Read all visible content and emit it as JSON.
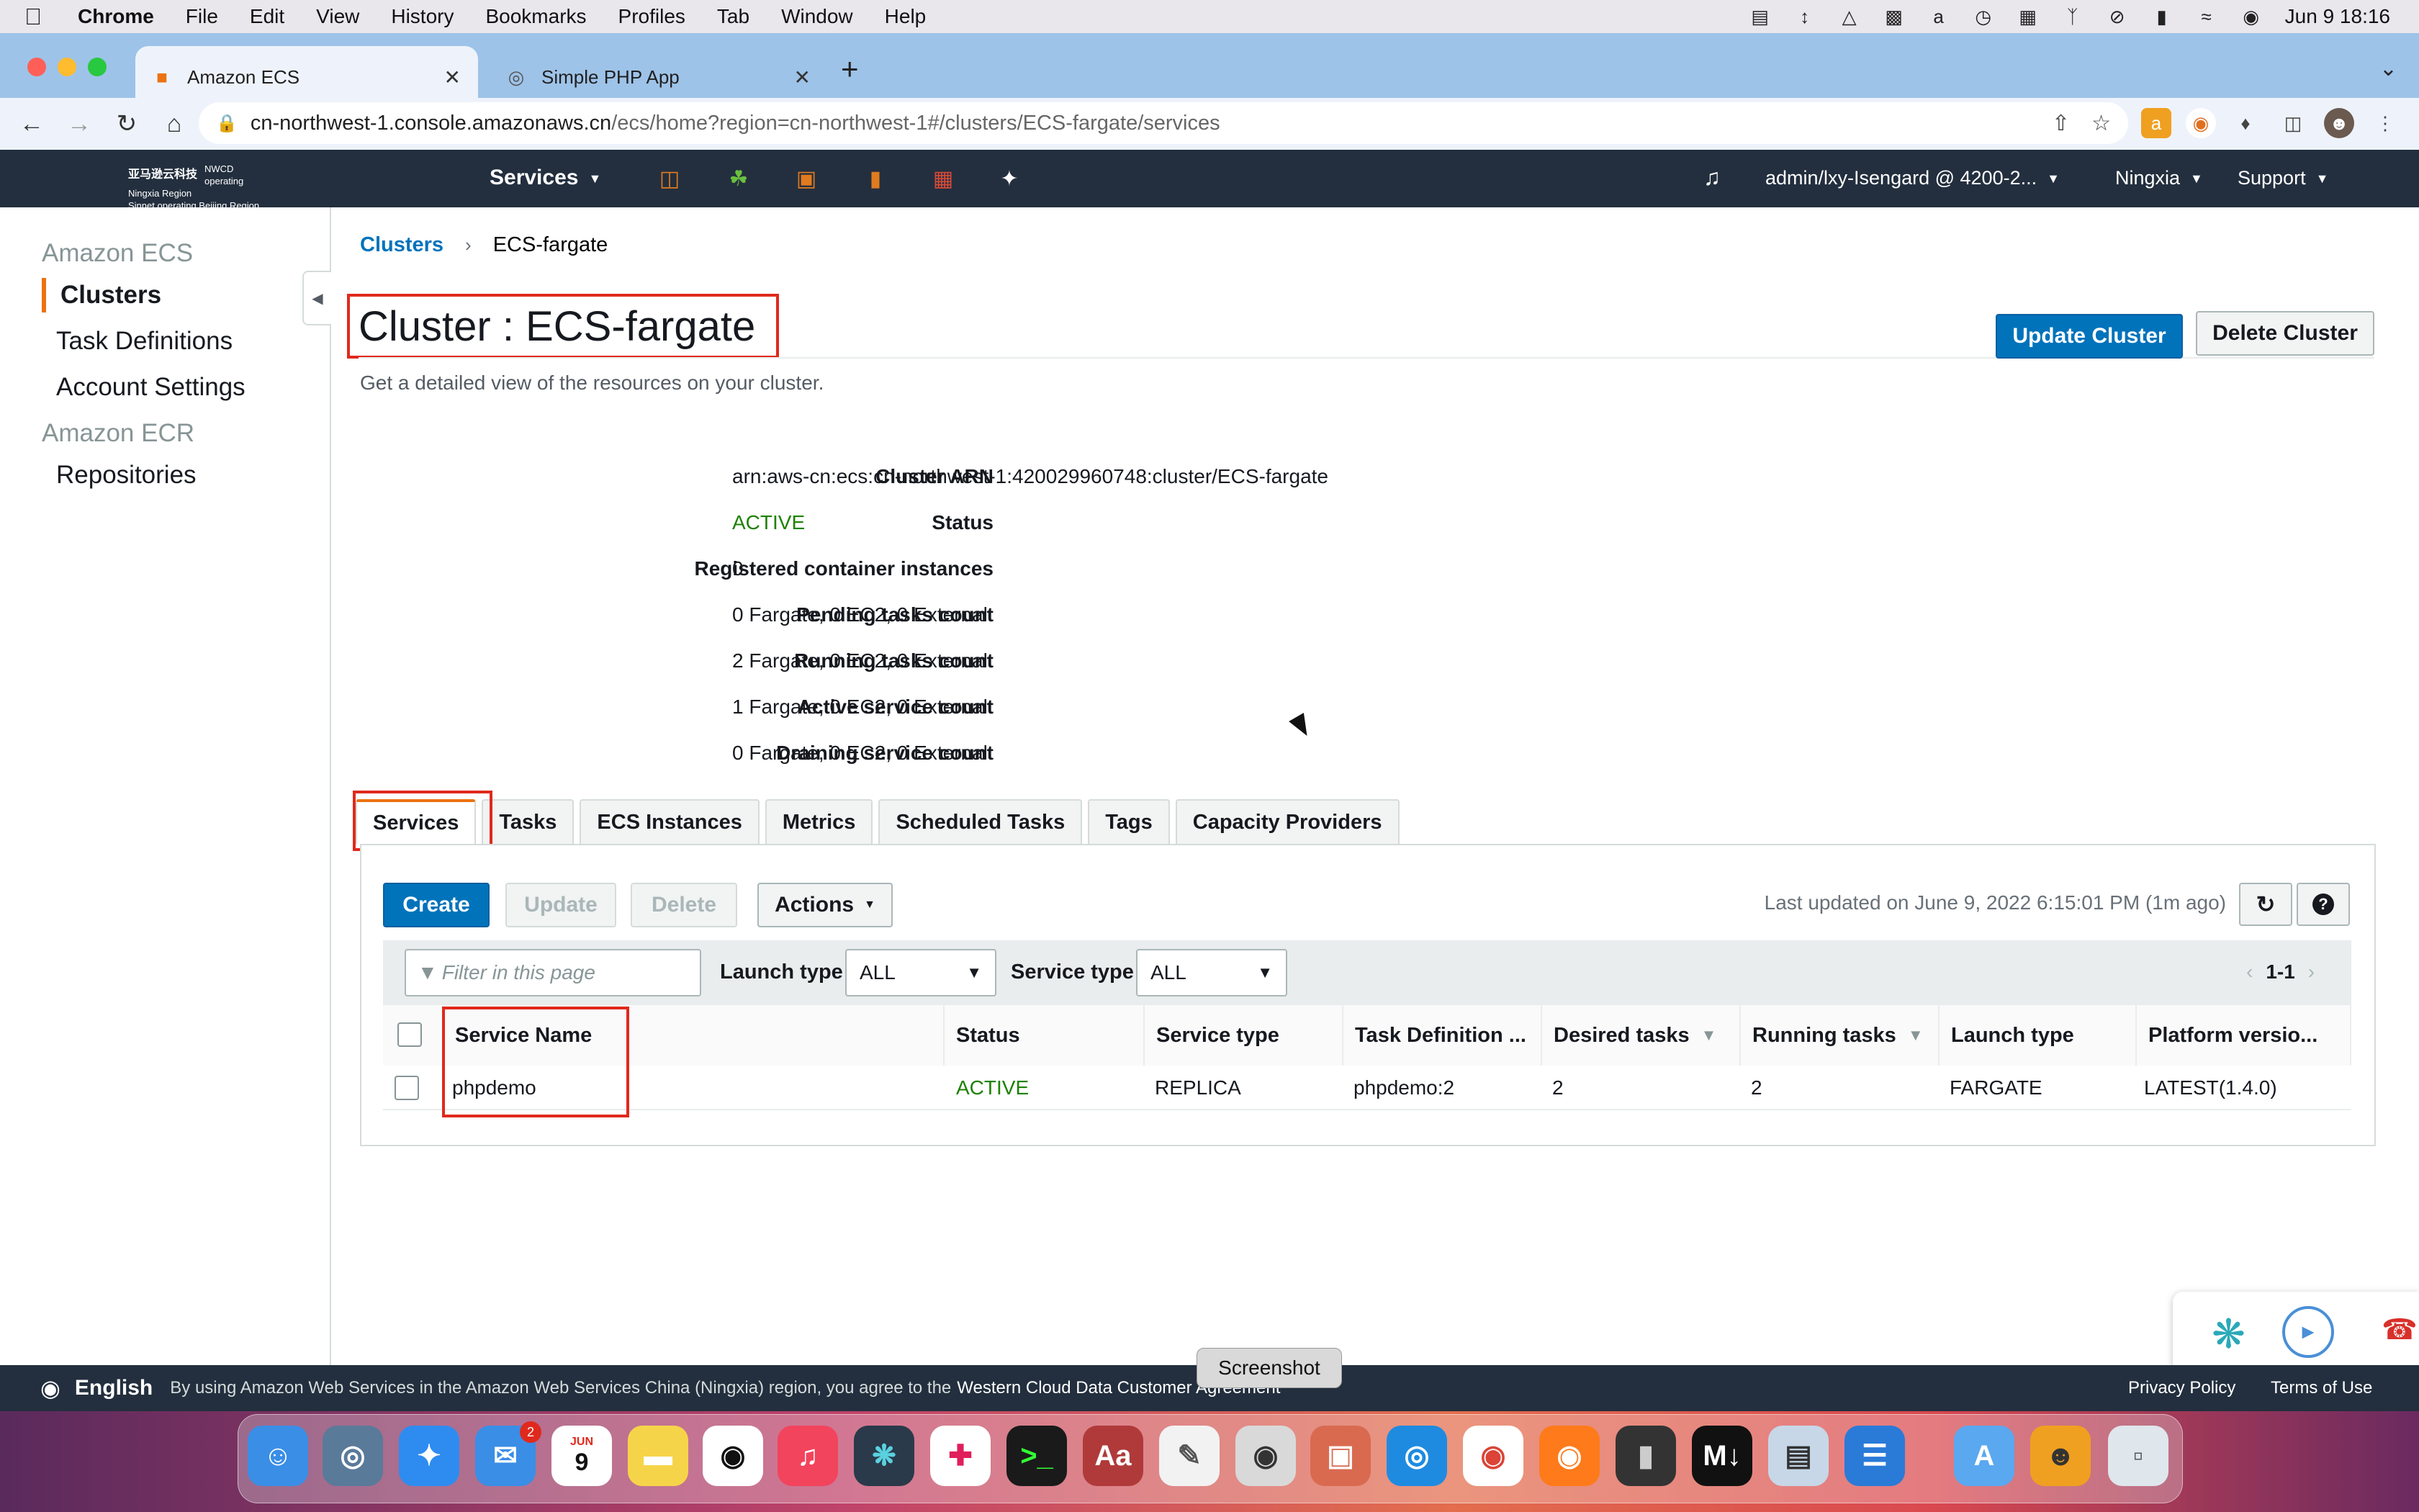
{
  "menubar": {
    "app": "Chrome",
    "items": [
      "File",
      "Edit",
      "View",
      "History",
      "Bookmarks",
      "Profiles",
      "Tab",
      "Window",
      "Help"
    ],
    "clock": "Jun 9  18:16"
  },
  "browser": {
    "tabs": [
      {
        "title": "Amazon ECS",
        "active": true
      },
      {
        "title": "Simple PHP App",
        "active": false
      }
    ],
    "url_host": "cn-northwest-1.console.amazonaws.cn",
    "url_path": "/ecs/home?region=cn-northwest-1#/clusters/ECS-fargate/services"
  },
  "aws_header": {
    "logo_line1": "NWCD operating Ningxia Region",
    "logo_line2": "Sinnet operating Beijing Region",
    "logo_cn": "亚马逊云科技",
    "services": "Services",
    "user": "admin/lxy-Isengard @ 4200-2...",
    "region": "Ningxia",
    "support": "Support"
  },
  "sidebar": {
    "section_ecs": "Amazon ECS",
    "items_ecs": [
      "Clusters",
      "Task Definitions",
      "Account Settings"
    ],
    "section_ecr": "Amazon ECR",
    "items_ecr": [
      "Repositories"
    ]
  },
  "breadcrumb": {
    "root": "Clusters",
    "current": "ECS-fargate"
  },
  "page": {
    "title": "Cluster : ECS-fargate",
    "subtitle": "Get a detailed view of the resources on your cluster.",
    "update_button": "Update Cluster",
    "delete_button": "Delete Cluster"
  },
  "details": [
    {
      "label": "Cluster ARN",
      "value": "arn:aws-cn:ecs:cn-northwest-1:420029960748:cluster/ECS-fargate"
    },
    {
      "label": "Status",
      "value": "ACTIVE"
    },
    {
      "label": "Registered container instances",
      "value": "0"
    },
    {
      "label": "Pending tasks count",
      "value": "0 Fargate, 0 EC2, 0 External"
    },
    {
      "label": "Running tasks count",
      "value": "2 Fargate, 0 EC2, 0 External"
    },
    {
      "label": "Active service count",
      "value": "1 Fargate, 0 EC2, 0 External"
    },
    {
      "label": "Draining service count",
      "value": "0 Fargate, 0 EC2, 0 External"
    }
  ],
  "tabs": [
    "Services",
    "Tasks",
    "ECS Instances",
    "Metrics",
    "Scheduled Tasks",
    "Tags",
    "Capacity Providers"
  ],
  "services_panel": {
    "create": "Create",
    "update": "Update",
    "delete": "Delete",
    "actions": "Actions",
    "last_updated": "Last updated on June 9, 2022 6:15:01 PM (1m ago)",
    "filter_placeholder": "Filter in this page",
    "launch_type_label": "Launch type",
    "launch_type_value": "ALL",
    "service_type_label": "Service type",
    "service_type_value": "ALL",
    "pager": "1-1"
  },
  "table": {
    "columns": [
      "Service Name",
      "Status",
      "Service type",
      "Task Definition ...",
      "Desired tasks",
      "Running tasks",
      "Launch type",
      "Platform versio..."
    ],
    "rows": [
      {
        "service_name": "phpdemo",
        "status": "ACTIVE",
        "service_type": "REPLICA",
        "task_definition": "phpdemo:2",
        "desired": "2",
        "running": "2",
        "launch_type": "FARGATE",
        "platform": "LATEST(1.4.0)"
      }
    ]
  },
  "footer": {
    "language": "English",
    "message": "By using Amazon Web Services in the Amazon Web Services China (Ningxia) region, you agree to the",
    "link": "Western Cloud Data Customer Agreement",
    "privacy": "Privacy Policy",
    "terms": "Terms of Use"
  },
  "tooltip": "Screenshot",
  "dock": {
    "calendar_month": "JUN",
    "calendar_day": "9",
    "mail_badge": "2"
  },
  "colors": {
    "aws_nav": "#232f3e",
    "link": "#0073bb",
    "primary": "#0073bb",
    "active_green": "#1d8102",
    "accent_orange": "#ec7211",
    "highlight_red": "#e0291d"
  }
}
